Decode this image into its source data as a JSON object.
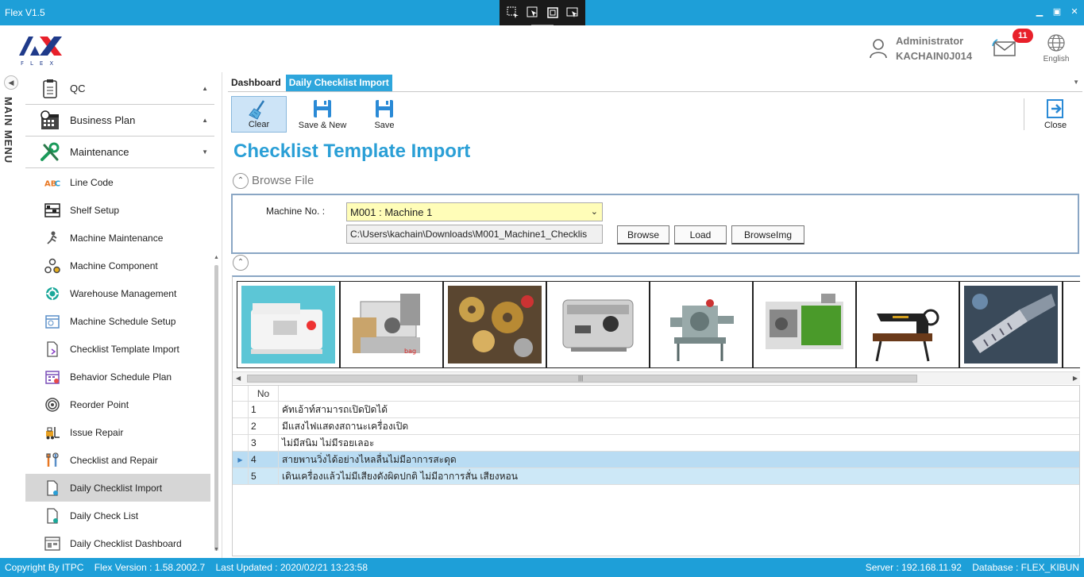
{
  "app": {
    "title": "Flex V1.5"
  },
  "header": {
    "user_role": "Administrator",
    "user_id": "KACHAIN0J014",
    "notification_count": "11",
    "language": "English",
    "logo_text": "FLEX"
  },
  "main_menu": {
    "label": "MAIN MENU"
  },
  "sidebar": {
    "groups": [
      {
        "label": "QC",
        "icon": "clipboard-icon"
      },
      {
        "label": "Business Plan",
        "icon": "calendar-icon"
      },
      {
        "label": "Maintenance",
        "icon": "tools-icon"
      }
    ],
    "items": [
      {
        "label": "Line Code",
        "icon": "abc-icon"
      },
      {
        "label": "Shelf Setup",
        "icon": "shelf-icon"
      },
      {
        "label": "Machine Maintenance",
        "icon": "worker-icon"
      },
      {
        "label": "Machine Component",
        "icon": "component-icon"
      },
      {
        "label": "Warehouse Management",
        "icon": "gear-icon"
      },
      {
        "label": "Machine Schedule Setup",
        "icon": "schedule-icon"
      },
      {
        "label": "Checklist Template Import",
        "icon": "document-import-icon"
      },
      {
        "label": "Behavior Schedule Plan",
        "icon": "calendar-plan-icon"
      },
      {
        "label": "Reorder Point",
        "icon": "target-icon"
      },
      {
        "label": "Issue Repair",
        "icon": "forklift-icon"
      },
      {
        "label": "Checklist and Repair",
        "icon": "wrench-icon"
      },
      {
        "label": "Daily Checklist Import",
        "icon": "document-icon"
      },
      {
        "label": "Daily Check List",
        "icon": "document-check-icon"
      },
      {
        "label": "Daily Checklist Dashboard",
        "icon": "dashboard-icon"
      }
    ],
    "active_item": "Daily Checklist Import"
  },
  "tabs": [
    {
      "label": "Dashboard"
    },
    {
      "label": "Daily Checklist Import"
    }
  ],
  "toolbar": {
    "clear": "Clear",
    "save_new": "Save & New",
    "save": "Save",
    "close": "Close"
  },
  "page_title": "Checklist Template Import",
  "browse": {
    "section_label": "Browse File",
    "machine_label": "Machine No. :",
    "machine_value": "M001 : Machine 1",
    "path_value": "C:\\Users\\kachain\\Downloads\\M001_Machine1_Checklis",
    "browse_btn": "Browse",
    "load_btn": "Load",
    "browse_img_btn": "BrowseImg"
  },
  "gallery": [
    {
      "icon": "sewing-machine-image"
    },
    {
      "icon": "bag-machine-image"
    },
    {
      "icon": "gear-mechanism-image"
    },
    {
      "icon": "espresso-machine-image"
    },
    {
      "icon": "industrial-machine-image"
    },
    {
      "icon": "green-machine-image"
    },
    {
      "icon": "vintage-sewing-machine-image"
    },
    {
      "icon": "drill-image"
    }
  ],
  "grid": {
    "header_no": "No",
    "rows": [
      {
        "no": "1",
        "text": "คัทเอ้าท์สามารถเปิดปิดได้"
      },
      {
        "no": "2",
        "text": "มีแสงไฟแสดงสถานะเครื่องเปิด"
      },
      {
        "no": "3",
        "text": "ไม่มีสนิม ไม่มีรอยเลอะ"
      },
      {
        "no": "4",
        "text": "สายพานวิ่งได้อย่างไหลลื่นไม่มีอาการสะดุด"
      },
      {
        "no": "5",
        "text": "เดินเครื่องแล้วไม่มีเสียงดังผิดปกติ ไม่มีอาการสั่น เสียงหอน"
      }
    ]
  },
  "status": {
    "copyright": "Copyright By ITPC",
    "version": "Flex Version : 1.58.2002.7",
    "updated": "Last Updated : 2020/02/21 13:23:58",
    "server": "Server : 192.168.11.92",
    "database": "Database : FLEX_KIBUN"
  },
  "colors": {
    "accent": "#1e9fd8",
    "title": "#2a9fd6",
    "selection": "#b9dcf3",
    "field_yellow": "#fffdb8"
  }
}
